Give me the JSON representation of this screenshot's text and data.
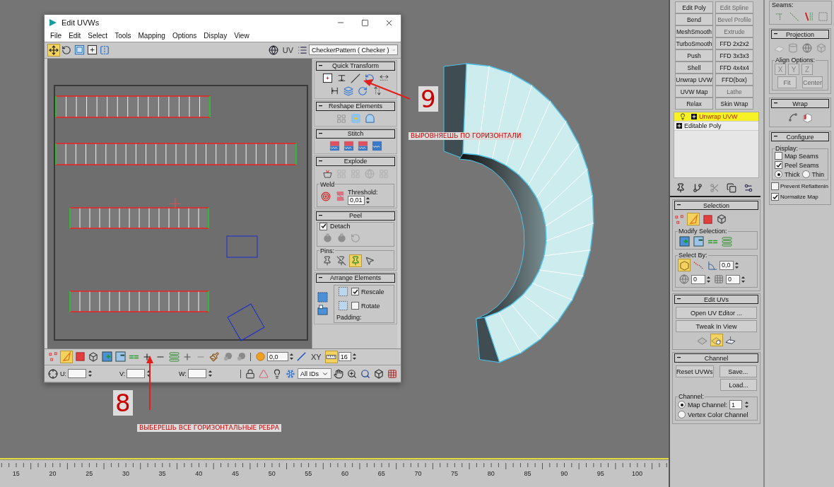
{
  "uv_editor": {
    "title": "Edit UVWs",
    "menu": [
      "File",
      "Edit",
      "Select",
      "Tools",
      "Mapping",
      "Options",
      "Display",
      "View"
    ],
    "top_tools": [
      {
        "kind": "move",
        "selected": true
      },
      {
        "kind": "rotate",
        "selected": false
      },
      {
        "kind": "scale",
        "selected": false
      },
      {
        "kind": "freeform",
        "selected": false
      },
      {
        "kind": "mirror",
        "selected": false
      }
    ],
    "uv_label": "UV",
    "texture_dropdown": "CheckerPattern  ( Checker )",
    "rollouts": [
      {
        "kind": "tools",
        "title": "Quick Transform",
        "tools": [
          {
            "kind": "pivot"
          },
          {
            "kind": "align-v"
          },
          {
            "kind": "straighten"
          },
          {
            "kind": "rotate-ccw"
          },
          {
            "kind": "space-h"
          },
          {
            "kind": "align-h"
          },
          {
            "kind": "relax"
          },
          {
            "kind": "rotate-cw"
          },
          {
            "kind": "space-v"
          }
        ]
      },
      {
        "kind": "tools",
        "title": "Reshape Elements",
        "tools": [
          {
            "kind": "reshape-grid"
          },
          {
            "kind": "relax-light"
          },
          {
            "kind": "arc"
          }
        ]
      },
      {
        "kind": "tools",
        "title": "Stitch",
        "tools": [
          {
            "kind": "stitch"
          },
          {
            "kind": "stitch"
          },
          {
            "kind": "stitch"
          },
          {
            "kind": "stitch-blue"
          }
        ]
      },
      {
        "kind": "explode",
        "title": "Explode",
        "tools": [
          {
            "kind": "break",
            "disabled": false
          },
          {
            "kind": "explode",
            "disabled": true
          },
          {
            "kind": "explode",
            "disabled": true
          },
          {
            "kind": "sphere-grey",
            "disabled": true
          },
          {
            "kind": "explode",
            "disabled": true
          }
        ],
        "weld_label": "Weld",
        "weld_tools": [
          {
            "kind": "weld-target"
          },
          {
            "kind": "weld-pair"
          }
        ],
        "threshold_label": "Threshold:",
        "threshold": "0,01"
      },
      {
        "kind": "peel",
        "title": "Peel",
        "detach": {
          "label": "Detach",
          "checked": true
        },
        "tools": [
          {
            "kind": "peel"
          },
          {
            "kind": "peel"
          },
          {
            "kind": "peel-reset"
          }
        ],
        "pins_label": "Pins:",
        "pins": [
          {
            "kind": "pin",
            "selected": false
          },
          {
            "kind": "pin-remove",
            "selected": false
          },
          {
            "kind": "pin-auto",
            "selected": true
          },
          {
            "kind": "pin-select",
            "selected": false
          }
        ]
      },
      {
        "kind": "arrange",
        "title": "Arrange Elements",
        "tools": [
          {
            "kind": "pack"
          },
          {
            "kind": "pack-group"
          }
        ],
        "group_tools": [
          {
            "kind": "pack-dotted"
          },
          {
            "kind": "pack-dotted"
          }
        ],
        "options": [
          {
            "label": "Rescale",
            "checked": true
          },
          {
            "label": "Rotate",
            "checked": false
          }
        ],
        "padding_label": "Padding:"
      }
    ],
    "selection_tools": [
      {
        "kind": "vertex",
        "selected": false
      },
      {
        "kind": "edge",
        "selected": true
      },
      {
        "kind": "face",
        "selected": false
      },
      {
        "kind": "element",
        "selected": false
      },
      {
        "kind": "grow",
        "selected": false
      },
      {
        "kind": "shrink",
        "selected": false
      },
      {
        "kind": "ring",
        "selected": false
      },
      {
        "kind": "add",
        "selected": false
      },
      {
        "kind": "subtract",
        "selected": false
      },
      {
        "kind": "loop",
        "selected": false
      },
      {
        "kind": "add-grey",
        "selected": false
      },
      {
        "kind": "subtract-grey",
        "selected": false
      },
      {
        "kind": "paint",
        "selected": false
      },
      {
        "kind": "soft",
        "selected": false
      },
      {
        "kind": "soft",
        "selected": false
      }
    ],
    "soft_tool": {
      "kind": "soft-circle",
      "selected": false
    },
    "soft_value": "0,0",
    "axis_tool": {
      "kind": "line",
      "selected": false
    },
    "axis_label": "XY",
    "snap_tool": {
      "kind": "snap",
      "selected": true
    },
    "step_value": "16",
    "center_tool": {
      "kind": "target"
    },
    "coords": [
      {
        "label": "U:"
      },
      {
        "label": "V:"
      },
      {
        "label": "W:"
      }
    ],
    "display_tools": [
      {
        "kind": "lock"
      },
      {
        "kind": "filter"
      },
      {
        "kind": "light"
      },
      {
        "kind": "freeze"
      }
    ],
    "id_filter": "All IDs",
    "view_tools": [
      {
        "kind": "pan"
      },
      {
        "kind": "zoom"
      },
      {
        "kind": "zoom-region"
      },
      {
        "kind": "view-box"
      },
      {
        "kind": "checker"
      }
    ]
  },
  "annotations": [
    {
      "kind": "number",
      "text": "9"
    },
    {
      "kind": "note",
      "text": "ВЫРОВНЯЕШЬ ПО ГОРИЗОНТАЛИ"
    },
    {
      "kind": "number",
      "text": "8"
    },
    {
      "kind": "note",
      "text": "ВЫБЕРЕШЬ ВСЕ ГОРИЗОНТАЛЬНЫЕ РЕБРА"
    }
  ],
  "command_panel": {
    "modifier_buttons": [
      {
        "label": "Edit Poly",
        "disabled": false
      },
      {
        "label": "Edit Spline",
        "disabled": true
      },
      {
        "label": "Bend",
        "disabled": false
      },
      {
        "label": "Bevel Profile",
        "disabled": true
      },
      {
        "label": "MeshSmooth",
        "disabled": false
      },
      {
        "label": "Extrude",
        "disabled": true
      },
      {
        "label": "TurboSmooth",
        "disabled": false
      },
      {
        "label": "FFD 2x2x2",
        "disabled": false
      },
      {
        "label": "Push",
        "disabled": false
      },
      {
        "label": "FFD 3x3x3",
        "disabled": false
      },
      {
        "label": "Shell",
        "disabled": false
      },
      {
        "label": "FFD 4x4x4",
        "disabled": false
      },
      {
        "label": "Unwrap UVW",
        "disabled": false
      },
      {
        "label": "FFD(box)",
        "disabled": false
      },
      {
        "label": "UVW Map",
        "disabled": false
      },
      {
        "label": "Lathe",
        "disabled": true
      },
      {
        "label": "Relax",
        "disabled": false
      },
      {
        "label": "Skin Wrap",
        "disabled": false
      }
    ],
    "stack": [
      {
        "kind": "modifier",
        "label": "Unwrap UVW",
        "selected": true
      },
      {
        "kind": "object",
        "label": "Editable Poly",
        "selected": false
      }
    ],
    "stack_tools": [
      {
        "kind": "stack-pin"
      },
      {
        "kind": "fork"
      },
      {
        "kind": "cut"
      },
      {
        "kind": "paste"
      },
      {
        "kind": "config"
      }
    ],
    "selection": {
      "title": "Selection",
      "modes": [
        {
          "kind": "vertex",
          "selected": false
        },
        {
          "kind": "edge",
          "selected": true
        },
        {
          "kind": "face",
          "selected": false
        },
        {
          "kind": "element",
          "selected": false
        }
      ],
      "modify_label": "Modify Selection:",
      "modify_tools": [
        {
          "kind": "grow"
        },
        {
          "kind": "shrink"
        },
        {
          "kind": "ring"
        },
        {
          "kind": "loop"
        }
      ],
      "select_by_label": "Select By:",
      "select_by": [
        {
          "kind": "element-uv",
          "selected": true
        },
        {
          "kind": "edge-path",
          "selected": false
        },
        {
          "kind": "angle",
          "selected": false,
          "value": "0,0"
        },
        {
          "kind": "sphere-grey",
          "selected": false,
          "value": "0"
        },
        {
          "kind": "grid",
          "selected": false,
          "value": "0"
        }
      ]
    },
    "edit_uvs": {
      "title": "Edit UVs",
      "buttons": [
        "Open UV Editor ...",
        "Tweak In View"
      ],
      "tools": [
        {
          "kind": "tweak",
          "selected": false
        },
        {
          "kind": "tweak-light",
          "selected": true
        },
        {
          "kind": "tweak-plane",
          "selected": false
        }
      ]
    },
    "channel": {
      "title": "Channel",
      "buttons": [
        "Reset UVWs",
        "Save...",
        "Load..."
      ],
      "group_label": "Channel:",
      "options": [
        {
          "label": "Map Channel:",
          "selected": true,
          "value": "1"
        },
        {
          "label": "Vertex Color Channel",
          "selected": false
        }
      ]
    },
    "seams": {
      "label": "Seams:",
      "tools": [
        {
          "kind": "seam-point"
        },
        {
          "kind": "seam-path"
        },
        {
          "kind": "seam-loop"
        },
        {
          "kind": "seam-box"
        }
      ]
    },
    "projection": {
      "title": "Projection",
      "tools": [
        {
          "kind": "plane"
        },
        {
          "kind": "cylinder"
        },
        {
          "kind": "sphere-grey"
        },
        {
          "kind": "box-grey"
        }
      ],
      "align_label": "Align Options:",
      "axes": [
        "X",
        "Y",
        "Z"
      ],
      "buttons": [
        {
          "label": "Fit",
          "disabled": true
        },
        {
          "label": "Center",
          "disabled": true
        }
      ]
    },
    "wrap": {
      "title": "Wrap",
      "tools": [
        {
          "kind": "spline"
        },
        {
          "kind": "box-red"
        }
      ]
    },
    "configure": {
      "title": "Configure",
      "display_label": "Display:",
      "display": [
        {
          "label": "Map Seams",
          "checked": false
        },
        {
          "label": "Peel Seams",
          "checked": true
        }
      ],
      "thickness": [
        {
          "label": "Thick",
          "selected": true
        },
        {
          "label": "Thin",
          "selected": false
        }
      ],
      "options": [
        {
          "label": "Prevent Reflattenin",
          "checked": false
        },
        {
          "label": "Normalize Map",
          "checked": true
        }
      ]
    }
  },
  "timeline": {
    "labels": [
      "15",
      "20",
      "25",
      "30",
      "35",
      "40",
      "45",
      "50",
      "55",
      "60",
      "65",
      "70",
      "75",
      "80",
      "85",
      "90",
      "95",
      "100"
    ]
  }
}
